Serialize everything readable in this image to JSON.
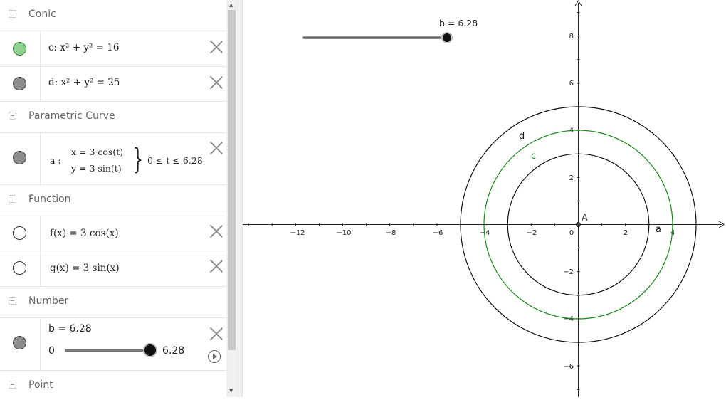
{
  "algebra": {
    "sections": {
      "conic": "Conic",
      "parametric": "Parametric Curve",
      "function": "Function",
      "number": "Number",
      "point": "Point"
    },
    "conic_c": {
      "text": "c: x² + y² = 16",
      "color": "#8fd18f"
    },
    "conic_d": {
      "text": "d: x² + y² = 25"
    },
    "param_a": {
      "label": "a :",
      "line1": "x = 3  cos(t)",
      "line2": "y = 3  sin(t)",
      "range": "0 ≤ t ≤ 6.28"
    },
    "func_f": "f(x)  =  3  cos(x)",
    "func_g": "g(x)  =  3  sin(x)",
    "number_b": {
      "text": "b = 6.28",
      "min": "0",
      "max": "6.28",
      "value": 6.28,
      "fraction": 1.0
    }
  },
  "graphics": {
    "slider_label": "b = 6.28",
    "slider_fraction": 1.0,
    "x_ticks": [
      "−12",
      "−10",
      "−8",
      "−6",
      "−4",
      "−2",
      "0",
      "2",
      "4"
    ],
    "y_ticks": [
      "8",
      "6",
      "4",
      "2",
      "−2",
      "−4",
      "−6"
    ],
    "labels": {
      "d": "d",
      "c": "c",
      "a": "a",
      "A": "A"
    },
    "colors": {
      "green": "#1a8a1a",
      "axis": "#222222",
      "circle": "#111111"
    }
  }
}
